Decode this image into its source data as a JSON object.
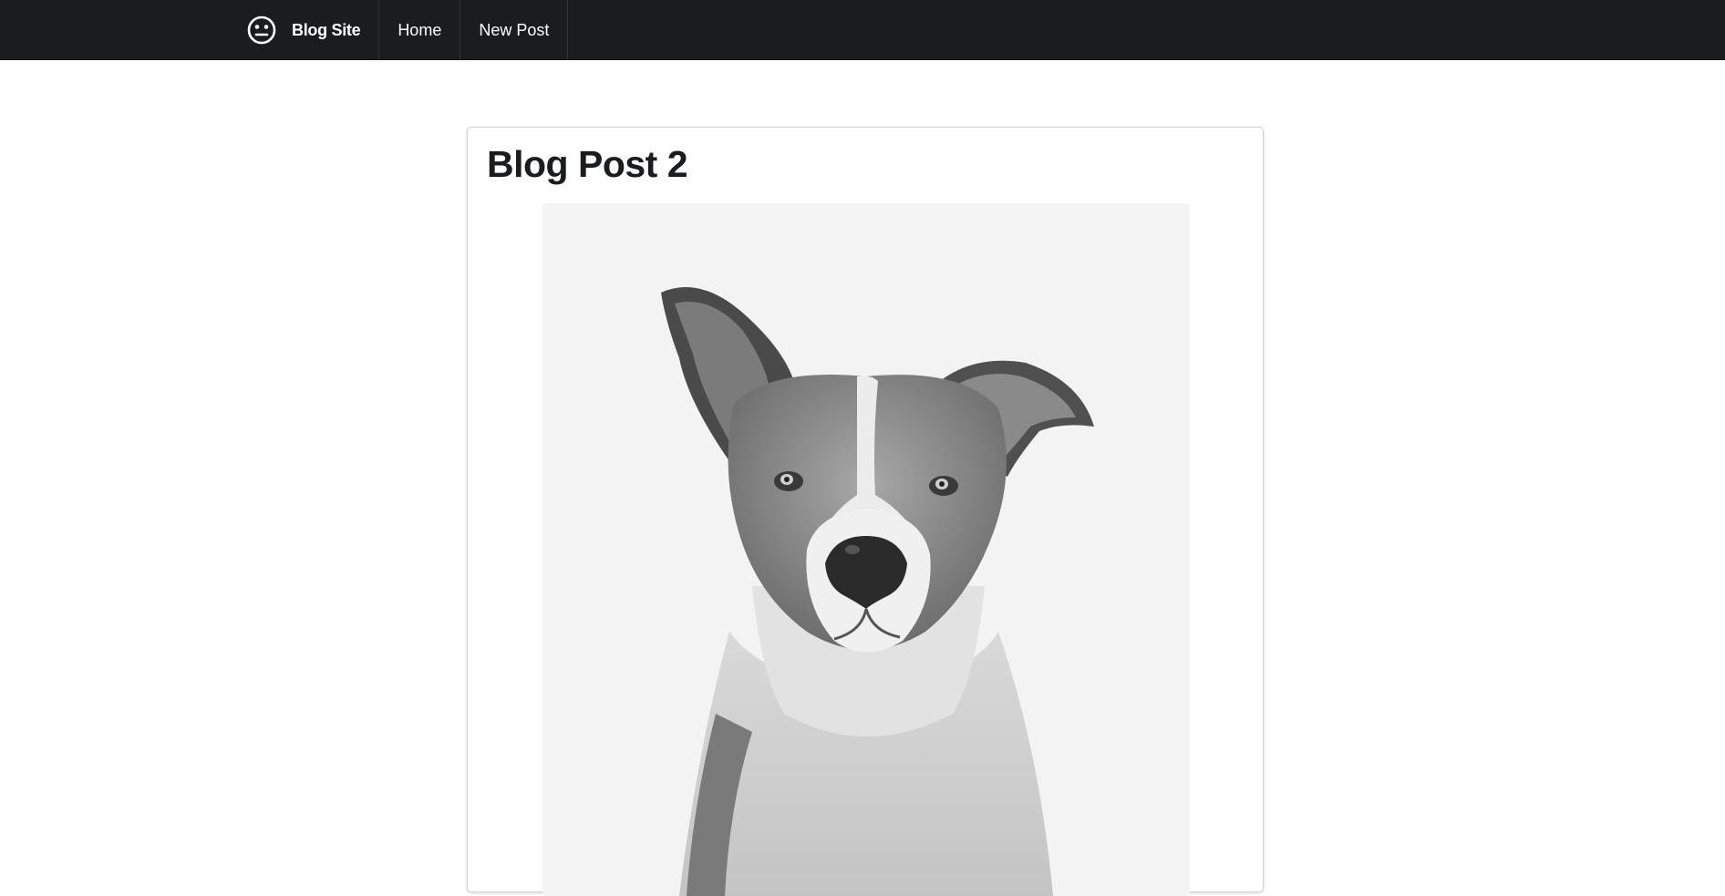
{
  "navbar": {
    "brand_icon": "meh-face-icon",
    "brand_label": "Blog Site",
    "items": [
      {
        "label": "Home"
      },
      {
        "label": "New Post"
      }
    ]
  },
  "post": {
    "title": "Blog Post 2",
    "image_subject": "dog-photo"
  },
  "colors": {
    "navbar_bg": "#1b1c1d",
    "text": "#1b1c1d",
    "image_bg": "#f3f3f3"
  }
}
